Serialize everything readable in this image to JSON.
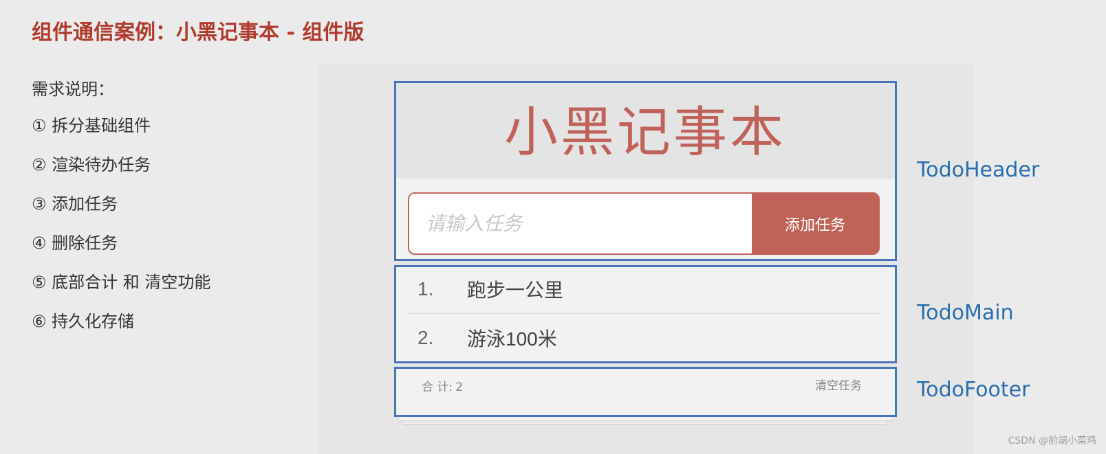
{
  "slide": {
    "title": "组件通信案例：小黑记事本 - 组件版",
    "requirements_heading": "需求说明：",
    "requirements": [
      "① 拆分基础组件",
      "② 渲染待办任务",
      "③ 添加任务",
      "④ 删除任务",
      "⑤ 底部合计 和 清空功能",
      "⑥ 持久化存储"
    ]
  },
  "app": {
    "title": "小黑记事本",
    "input_placeholder": "请输入任务",
    "input_value": "",
    "add_button_label": "添加任务",
    "todos": [
      {
        "index": "1.",
        "text": "跑步一公里"
      },
      {
        "index": "2.",
        "text": "游泳100米"
      }
    ],
    "footer": {
      "count_label": "合 计:",
      "count_value": "2",
      "clear_label": "清空任务"
    }
  },
  "component_labels": {
    "header": "TodoHeader",
    "main": "TodoMain",
    "footer": "TodoFooter"
  },
  "watermark": "CSDN @前端小菜鸡",
  "colors": {
    "slide_title": "#b03a2e",
    "app_accent": "#c0625a",
    "outline": "#4a74b8",
    "component_label": "#2a6db0"
  }
}
